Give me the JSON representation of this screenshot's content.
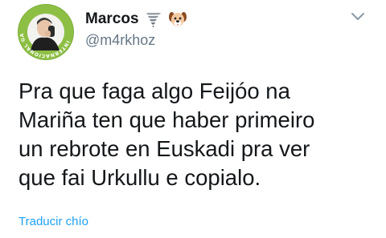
{
  "author": {
    "display_name": "Marcos",
    "handle": "@m4rkhoz",
    "name_emojis": [
      "tornado-icon",
      "dog-face-icon"
    ],
    "avatar_ring_text": "INTERNACIONAL GALEGO"
  },
  "tweet": {
    "text": "Pra que faga algo Feijóo na\nMariña ten que haber primeiro\nun rebrote en Euskadi pra ver\nque fai Urkullu e copialo.",
    "translate_link": "Traducir chío"
  },
  "colors": {
    "text": "#14171a",
    "secondary": "#657786",
    "link": "#1da1f2",
    "avatar_green": "#8dbf45"
  },
  "icons": {
    "menu": "chevron-down-icon"
  }
}
